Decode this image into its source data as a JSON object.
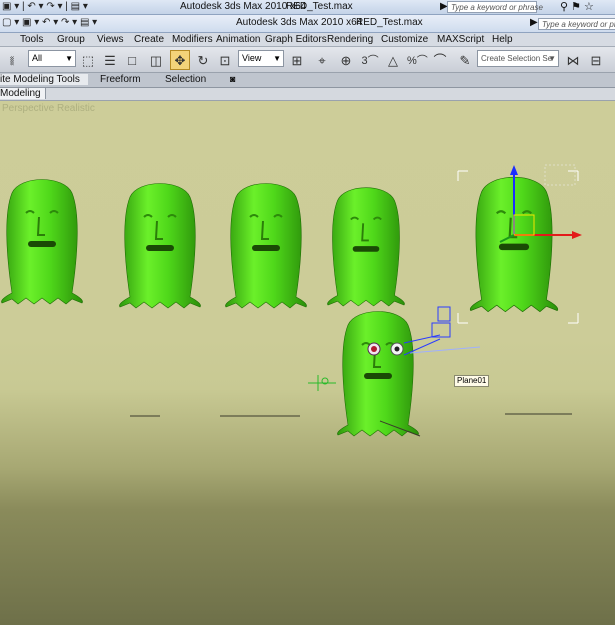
{
  "titlebar": {
    "app_title": "Autodesk 3ds Max  2010 x64",
    "file_name": "RED_Test.max",
    "search_placeholder": "Type a keyword or phrase"
  },
  "menu": [
    "Tools",
    "Group",
    "Views",
    "Create",
    "Modifiers",
    "Animation",
    "Graph Editors",
    "Rendering",
    "Customize",
    "MAXScript",
    "Help"
  ],
  "toolbar": {
    "selection_filter": "All",
    "reference_coord": "View",
    "selection_set_placeholder": "Create Selection Se",
    "snap_label": "3"
  },
  "ribbon": {
    "tabs": [
      "ite Modeling Tools",
      "Freeform",
      "Selection"
    ],
    "subtab": "Modeling"
  },
  "viewport": {
    "label": "Perspective Realistic",
    "selected_object_tag": "Plane01",
    "object_color": "#4fd81a"
  },
  "colors": {
    "accent": "#f3d37a",
    "viewport_bg": "#cdcd99"
  }
}
